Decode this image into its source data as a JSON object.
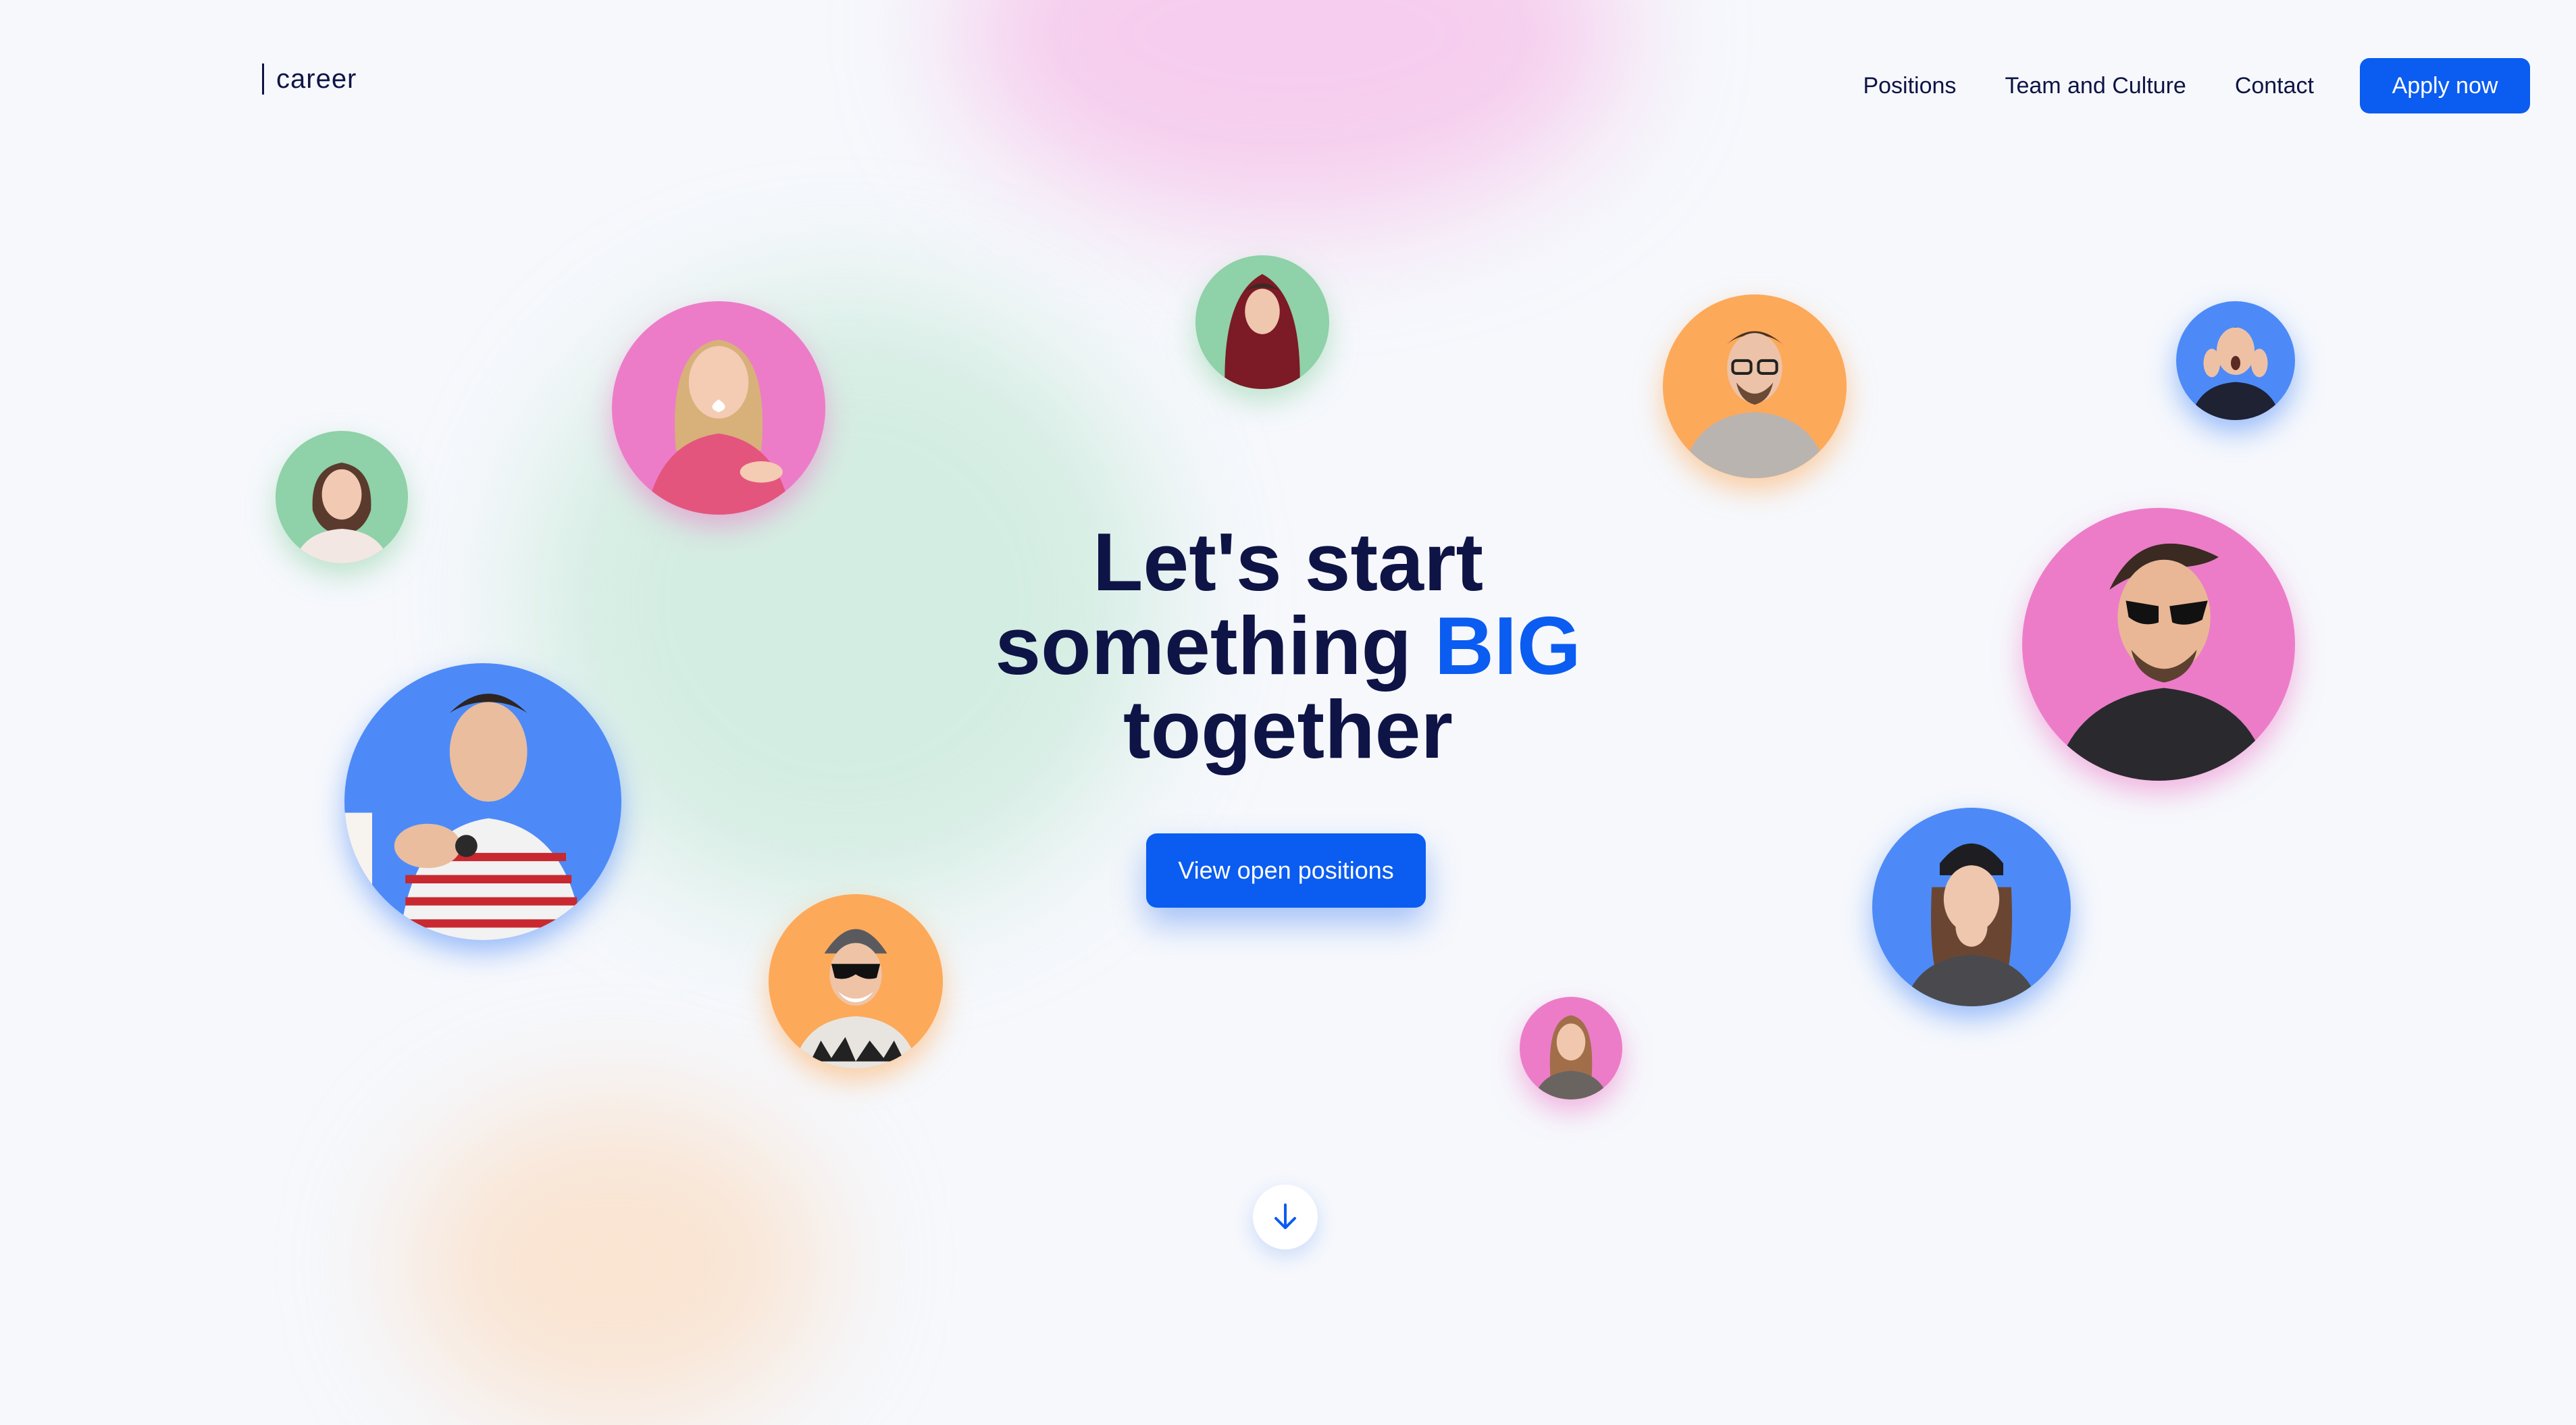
{
  "header": {
    "logo_text": "career",
    "nav": [
      "Positions",
      "Team and Culture",
      "Contact"
    ],
    "apply_label": "Apply now"
  },
  "hero": {
    "line1": "Let's start",
    "line2_a": "something ",
    "line2_b": "BIG",
    "line3": "together",
    "cta_label": "View open positions"
  },
  "icons": {
    "scroll": "arrow-down-icon"
  },
  "colors": {
    "accent": "#0b5cf0",
    "heading": "#0f1446",
    "background": "#f6f8fc",
    "green": "#8fd1a8",
    "pink": "#ec7cc8",
    "orange": "#fda95a",
    "blue": "#4d8af7"
  },
  "avatars": [
    {
      "id": "woman-1",
      "color": "green"
    },
    {
      "id": "woman-2",
      "color": "pink"
    },
    {
      "id": "man-hood",
      "color": "green"
    },
    {
      "id": "man-glasses",
      "color": "orange"
    },
    {
      "id": "man-surprised",
      "color": "blue"
    },
    {
      "id": "man-sunglasses",
      "color": "pink"
    },
    {
      "id": "woman-beanie",
      "color": "blue"
    },
    {
      "id": "woman-3",
      "color": "pink"
    },
    {
      "id": "man-beanie-sunglasses",
      "color": "orange"
    },
    {
      "id": "man-receipt",
      "color": "blue"
    }
  ]
}
